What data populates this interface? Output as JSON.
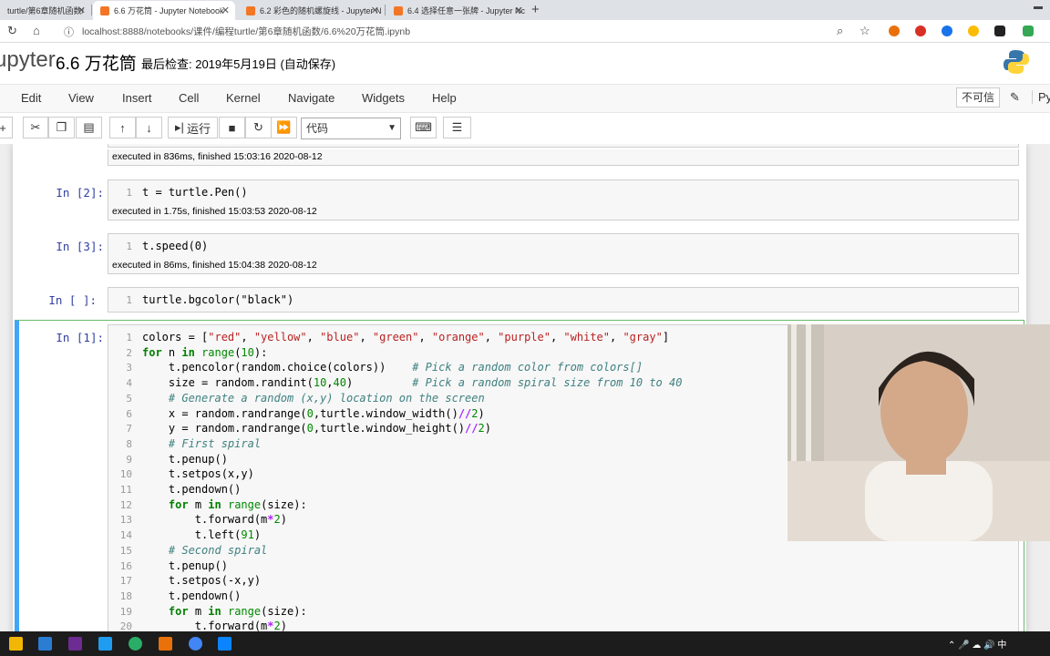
{
  "browser": {
    "tabs": [
      {
        "label": "turtle/第6章随机函数/"
      },
      {
        "label": "6.6 万花筒 - Jupyter Notebook"
      },
      {
        "label": "6.2 彩色的随机螺旋线 - Jupyter N"
      },
      {
        "label": "6.4 选择任意一张牌 - Jupyter Nc"
      }
    ],
    "url": "localhost:8888/notebooks/课件/编程turtle/第6章随机函数/6.6%20万花筒.ipynb"
  },
  "jupyter": {
    "logo_text": "upyter",
    "notebook_title": "6.6 万花筒",
    "checkpoint": "最后检查: 2019年5月19日  (自动保存)",
    "menu": [
      "Edit",
      "View",
      "Insert",
      "Cell",
      "Kernel",
      "Navigate",
      "Widgets",
      "Help"
    ],
    "untrusted": "不可信",
    "kernel_name": "Py",
    "toolbar": {
      "run_label": "运行",
      "cell_type": "代码"
    }
  },
  "cells": [
    {
      "exec": "executed in 836ms, finished 15:03:16 2020-08-12"
    },
    {
      "prompt": "In  [2]:",
      "line": "1",
      "code": "t = turtle.Pen()",
      "exec": "executed in 1.75s, finished 15:03:53 2020-08-12"
    },
    {
      "prompt": "In  [3]:",
      "line": "1",
      "code": "t.speed(0)",
      "exec": "executed in 86ms, finished 15:04:38 2020-08-12"
    },
    {
      "prompt": "In  [ ]:",
      "line": "1",
      "code": "turtle.bgcolor(\"black\")"
    },
    {
      "prompt": "In  [1]:"
    }
  ],
  "main_code": [
    "colors = [\"red\", \"yellow\", \"blue\", \"green\", \"orange\", \"purple\", \"white\", \"gray\"]",
    "for n in range(10):",
    "    t.pencolor(random.choice(colors))    # Pick a random color from colors[]",
    "    size = random.randint(10,40)         # Pick a random spiral size from 10 to 40",
    "    # Generate a random (x,y) location on the screen",
    "    x = random.randrange(0,turtle.window_width()//2)",
    "    y = random.randrange(0,turtle.window_height()//2)",
    "    # First spiral",
    "    t.penup()",
    "    t.setpos(x,y)",
    "    t.pendown()",
    "    for m in range(size):",
    "        t.forward(m*2)",
    "        t.left(91)",
    "    # Second spiral",
    "    t.penup()",
    "    t.setpos(-x,y)",
    "    t.pendown()",
    "    for m in range(size):",
    "        t.forward(m*2)"
  ],
  "taskbar": {
    "tray_text": "中"
  }
}
